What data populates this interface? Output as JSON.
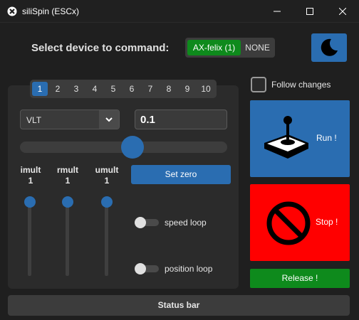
{
  "window": {
    "title": "siliSpin (ESCx)",
    "icons": {
      "app": "app-logo-icon",
      "minimize": "minimize-icon",
      "maximize": "maximize-icon",
      "close": "close-icon"
    }
  },
  "device": {
    "label": "Select device to command:",
    "options": [
      "AX-felix (1)",
      "NONE"
    ],
    "selected": "AX-felix (1)",
    "theme_icon": "moon-icon"
  },
  "tabs": {
    "items": [
      "1",
      "2",
      "3",
      "4",
      "5",
      "6",
      "7",
      "8",
      "9",
      "10"
    ],
    "active": "1"
  },
  "control": {
    "mode": "VLT",
    "value": "0.1",
    "slider_fraction": 0.55
  },
  "mults": [
    {
      "name": "imult",
      "value": "1"
    },
    {
      "name": "rmult",
      "value": "1"
    },
    {
      "name": "umult",
      "value": "1"
    }
  ],
  "buttons": {
    "set_zero": "Set zero",
    "run": "Run !",
    "stop": "Stop !",
    "release": "Release !"
  },
  "switches": {
    "speed_loop": {
      "label": "speed loop",
      "on": false
    },
    "position_loop": {
      "label": "position loop",
      "on": false
    }
  },
  "follow": {
    "label": "Follow changes",
    "checked": false
  },
  "status": {
    "text": "Status bar"
  },
  "colors": {
    "accent": "#2a6db1",
    "run": "#2a6db1",
    "stop": "#ff0000",
    "release": "#0e8a1c",
    "active_device": "#0e8a1c"
  }
}
